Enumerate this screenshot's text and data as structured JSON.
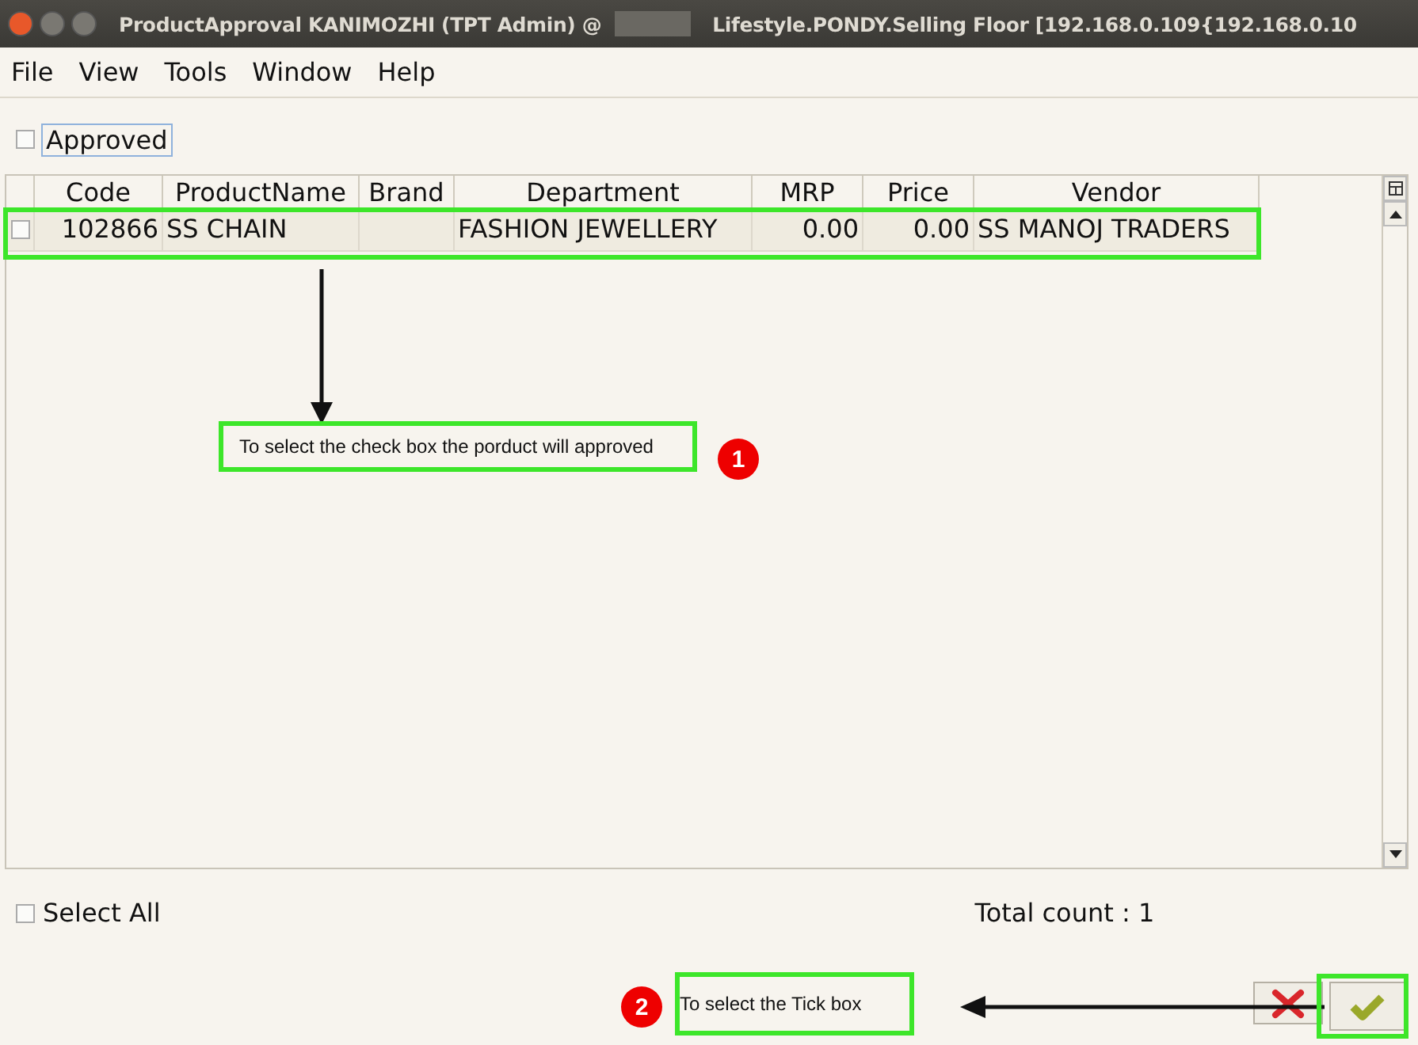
{
  "window": {
    "title": "ProductApproval  KANIMOZHI (TPT Admin) @",
    "title_tail": "Lifestyle.PONDY.Selling Floor [192.168.0.109{192.168.0.10"
  },
  "menu": [
    "File",
    "View",
    "Tools",
    "Window",
    "Help"
  ],
  "approved": {
    "label": "Approved",
    "checked": false
  },
  "table": {
    "columns": [
      "Code",
      "ProductName",
      "Brand",
      "Department",
      "MRP",
      "Price",
      "Vendor"
    ],
    "rows": [
      {
        "checked": false,
        "cells": [
          "102866",
          "SS CHAIN",
          "",
          "FASHION JEWELLERY",
          "0.00",
          "0.00",
          "SS MANOJ TRADERS"
        ]
      }
    ]
  },
  "select_all": {
    "label": "Select All",
    "checked": false
  },
  "total_count": "Total count : 1",
  "annotations": [
    {
      "number": "1",
      "text": "To select the check box the porduct will approved"
    },
    {
      "number": "2",
      "text": "To select the Tick box"
    }
  ]
}
